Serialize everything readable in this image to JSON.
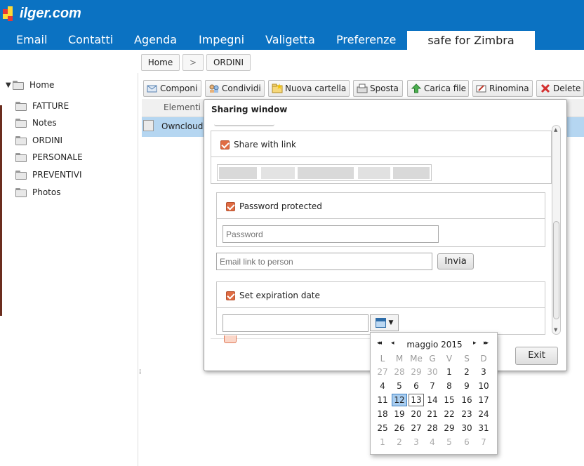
{
  "brand": {
    "name": "ilger.com"
  },
  "nav": {
    "tabs": [
      {
        "label": "Email",
        "active": false
      },
      {
        "label": "Contatti",
        "active": false
      },
      {
        "label": "Agenda",
        "active": false
      },
      {
        "label": "Impegni",
        "active": false
      },
      {
        "label": "Valigetta",
        "active": false
      },
      {
        "label": "Preferenze",
        "active": false
      },
      {
        "label": "safe for Zimbra",
        "active": true
      }
    ]
  },
  "breadcrumb": {
    "home": "Home",
    "separator": ">",
    "current": "ORDINI"
  },
  "tree": {
    "root": "Home",
    "folders": [
      "FATTURE",
      "Notes",
      "ORDINI",
      "PERSONALE",
      "PREVENTIVI",
      "Photos"
    ]
  },
  "toolbar": {
    "buttons": [
      {
        "label": "Componi",
        "icon": "compose-icon"
      },
      {
        "label": "Condividi",
        "icon": "share-icon"
      },
      {
        "label": "Nuova cartella",
        "icon": "new-folder-icon"
      },
      {
        "label": "Sposta",
        "icon": "move-icon"
      },
      {
        "label": "Carica file",
        "icon": "upload-icon"
      },
      {
        "label": "Rinomina",
        "icon": "rename-icon"
      },
      {
        "label": "Delete",
        "icon": "delete-icon"
      }
    ]
  },
  "list": {
    "column_header": "Elementi",
    "rows": [
      "Owncloud"
    ]
  },
  "dialog": {
    "title": "Sharing window",
    "share_with_link": {
      "label": "Share with link",
      "checked": true
    },
    "password_protected": {
      "label": "Password protected",
      "checked": true
    },
    "password": {
      "placeholder": "Password",
      "value": ""
    },
    "email": {
      "placeholder": "Email link to person",
      "value": ""
    },
    "send_button": "Invia",
    "set_expiration": {
      "label": "Set expiration date",
      "checked": true
    },
    "expiration_date": {
      "value": ""
    },
    "exit_button": "Exit"
  },
  "calendar": {
    "month_label": "maggio 2015",
    "prev_year": "◂◂",
    "prev_month": "◂",
    "next_month": "▸",
    "next_year": "▸▸",
    "weekdays": [
      "L",
      "M",
      "Me",
      "G",
      "V",
      "S",
      "D"
    ],
    "weeks": [
      [
        "27",
        "28",
        "29",
        "30",
        "1",
        "2",
        "3"
      ],
      [
        "4",
        "5",
        "6",
        "7",
        "8",
        "9",
        "10"
      ],
      [
        "11",
        "12",
        "13",
        "14",
        "15",
        "16",
        "17"
      ],
      [
        "18",
        "19",
        "20",
        "21",
        "22",
        "23",
        "24"
      ],
      [
        "25",
        "26",
        "27",
        "28",
        "29",
        "30",
        "31"
      ],
      [
        "1",
        "2",
        "3",
        "4",
        "5",
        "6",
        "7"
      ]
    ],
    "selected_day": "12",
    "today": "13"
  },
  "colors": {
    "header_bg": "#0b72c2",
    "selection": "#b5d6f1",
    "checkbox": "#e06c43"
  }
}
